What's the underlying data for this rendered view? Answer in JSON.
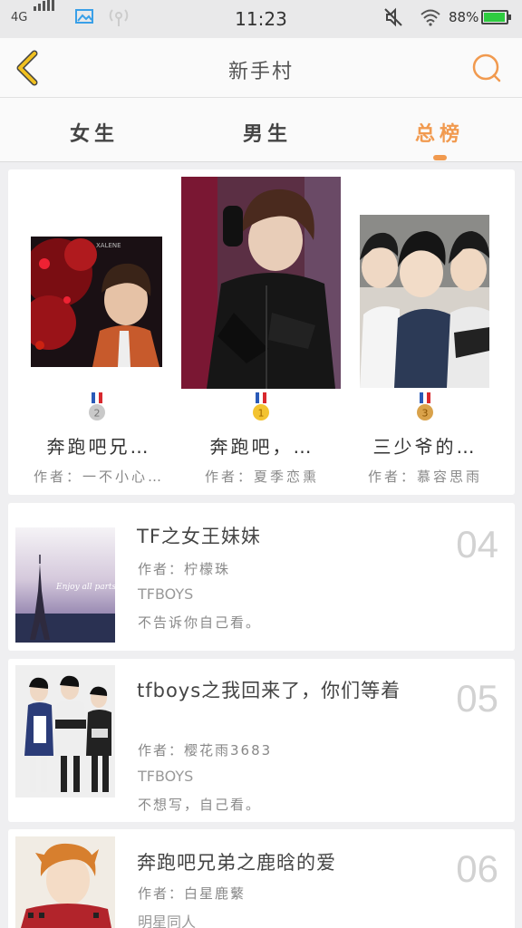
{
  "status_bar": {
    "network": "4G",
    "time": "11:23",
    "battery": "88%"
  },
  "header": {
    "title": "新手村",
    "back_icon": "chevron-left-icon",
    "search_icon": "search-icon"
  },
  "tabs": [
    {
      "label": "女生",
      "active": false
    },
    {
      "label": "男生",
      "active": false
    },
    {
      "label": "总榜",
      "active": true
    }
  ],
  "podium": [
    {
      "rank": 2,
      "title": "奔跑吧兄…",
      "author": "作者：一不小心…",
      "medal_color": "#c9c9c9"
    },
    {
      "rank": 1,
      "title": "奔跑吧，…",
      "author": "作者：夏季恋熏",
      "medal_color": "#f3c330"
    },
    {
      "rank": 3,
      "title": "三少爷的…",
      "author": "作者：慕容思雨",
      "medal_color": "#d9a24a"
    }
  ],
  "list": [
    {
      "rank": "04",
      "title": "TF之女王妹妹",
      "author": "作者：柠檬珠",
      "tag": "TFBOYS",
      "desc": "不告诉你自己看。",
      "cover_text": "Enjoy all parts"
    },
    {
      "rank": "05",
      "title": "tfboys之我回来了，你们等着",
      "author": "作者：樱花雨3683",
      "tag": "TFBOYS",
      "desc": "不想写，自己看。"
    },
    {
      "rank": "06",
      "title": "奔跑吧兄弟之鹿晗的爱",
      "author": "作者：白星鹿蘩",
      "tag": "明星同人",
      "desc": ""
    }
  ],
  "colors": {
    "accent": "#f19a4f",
    "back_arrow": "#f0c020",
    "battery": "#2ecc40"
  }
}
